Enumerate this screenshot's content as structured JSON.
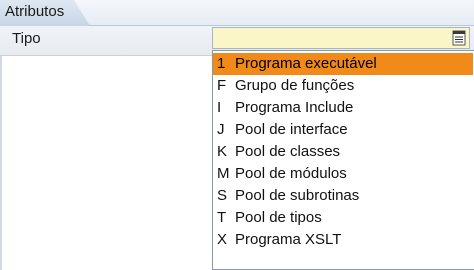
{
  "tab": {
    "label": "Atributos"
  },
  "field": {
    "label": "Tipo",
    "value": ""
  },
  "dropdown": {
    "options": [
      {
        "key": "1",
        "text": "Programa executável",
        "selected": true
      },
      {
        "key": "F",
        "text": "Grupo de funções",
        "selected": false
      },
      {
        "key": "I",
        "text": "Programa Include",
        "selected": false
      },
      {
        "key": "J",
        "text": "Pool de interface",
        "selected": false
      },
      {
        "key": "K",
        "text": "Pool de classes",
        "selected": false
      },
      {
        "key": "M",
        "text": "Pool de módulos",
        "selected": false
      },
      {
        "key": "S",
        "text": "Pool de subrotinas",
        "selected": false
      },
      {
        "key": "T",
        "text": "Pool de tipos",
        "selected": false
      },
      {
        "key": "X",
        "text": "Programa XSLT",
        "selected": false
      }
    ]
  },
  "colors": {
    "field_background": "#fbf6c8",
    "selected_option": "#f28a1a"
  },
  "icons": {
    "dropdown_button": "value-help-icon"
  }
}
